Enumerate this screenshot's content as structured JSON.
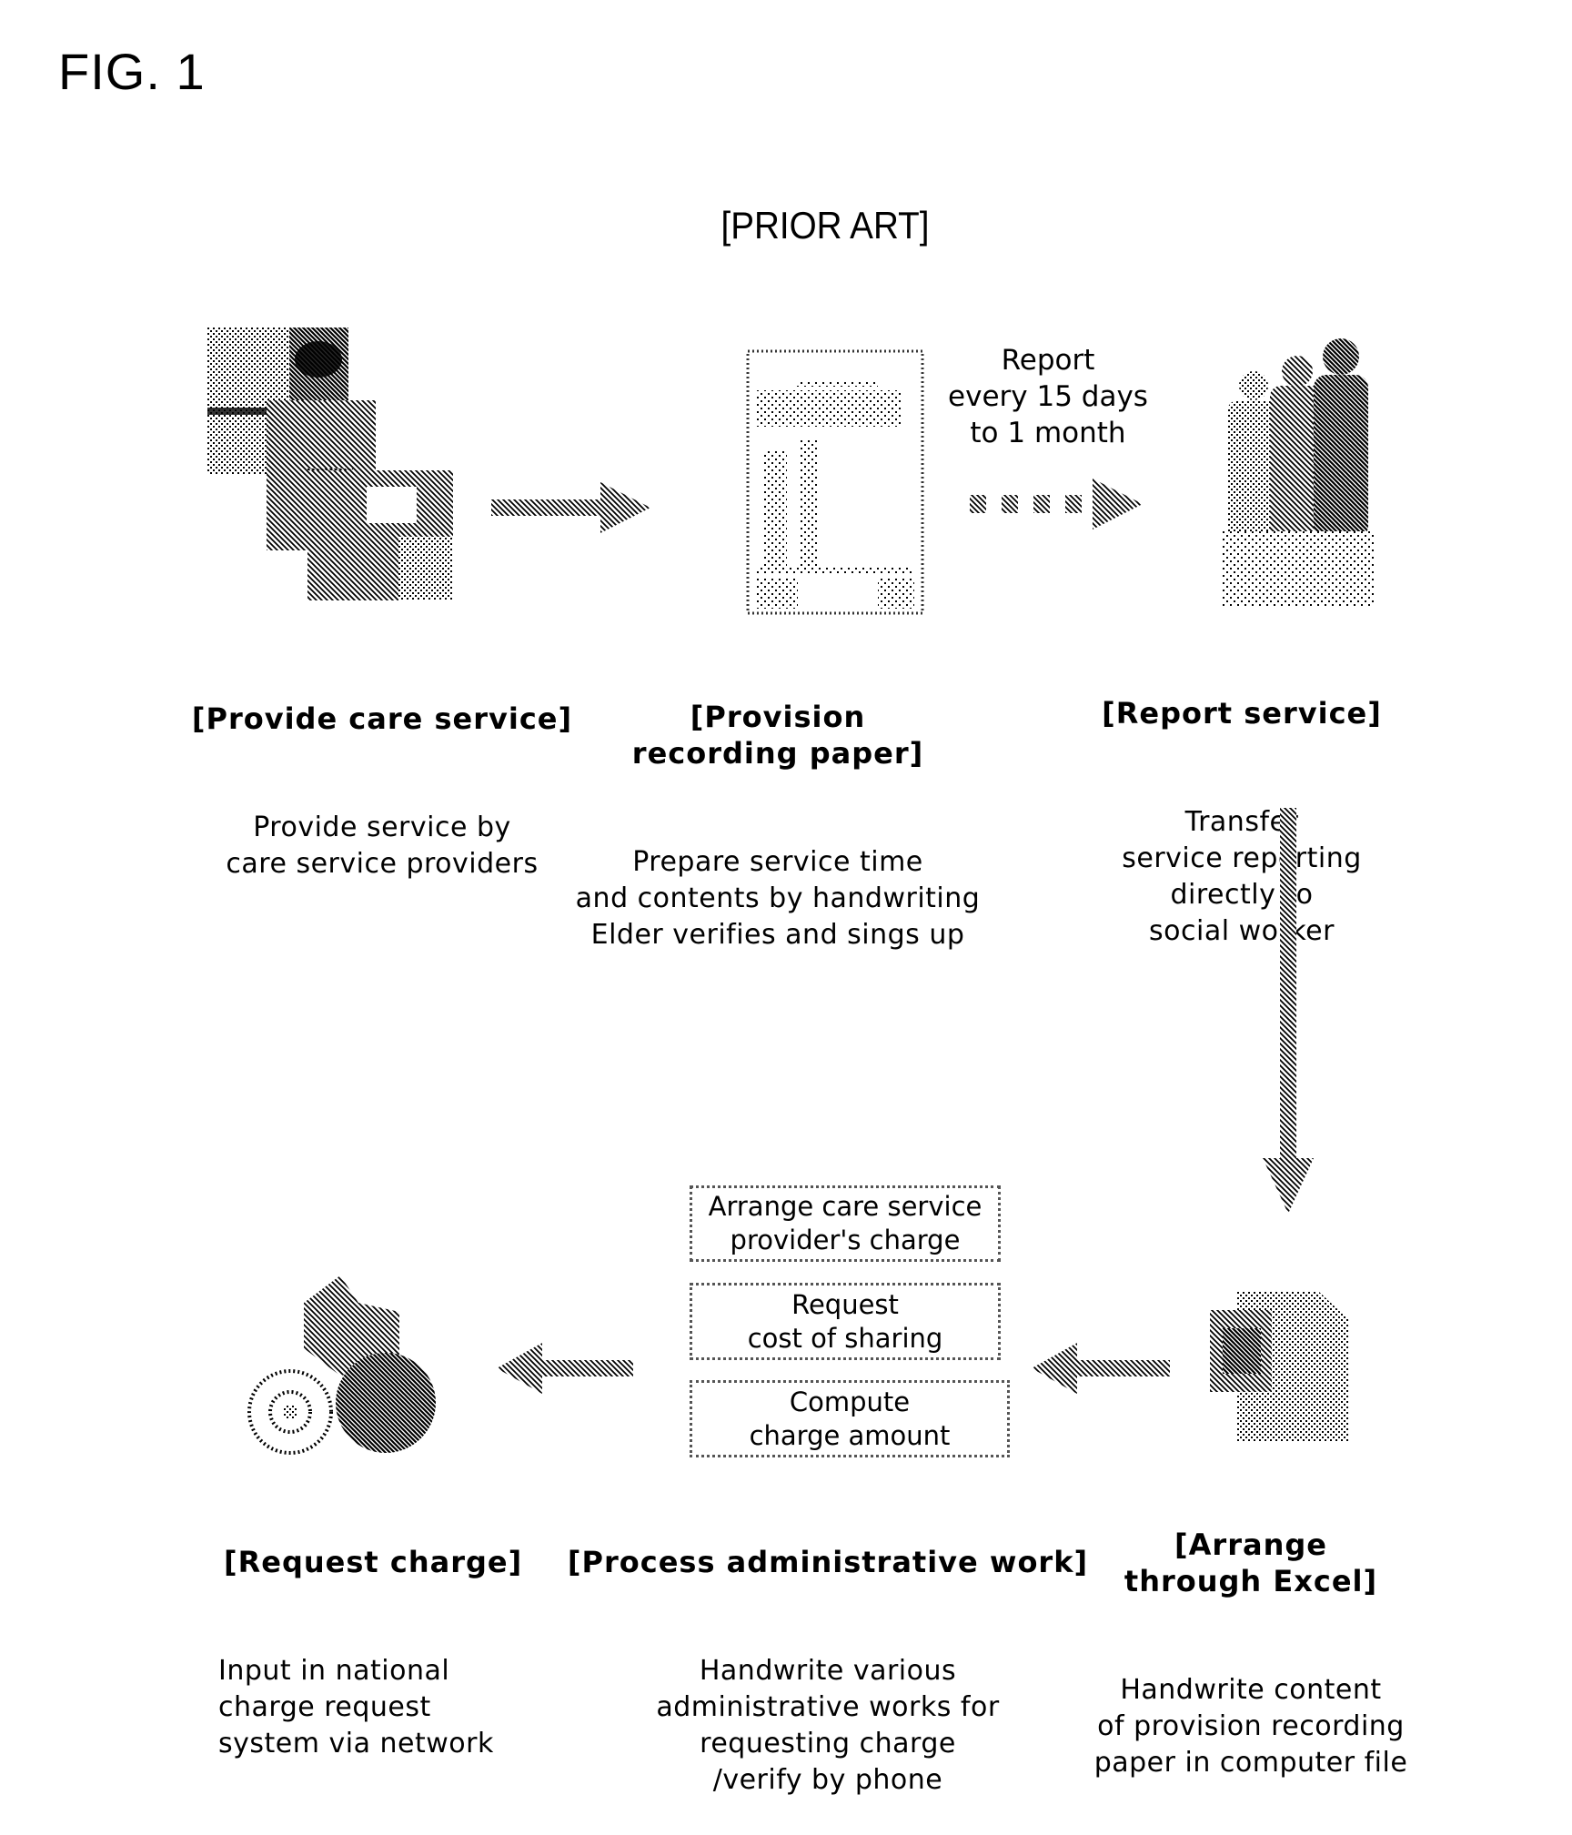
{
  "figure": {
    "title": "FIG. 1",
    "subtitle": "[PRIOR ART]"
  },
  "steps": [
    {
      "id": "provide-care-service",
      "icon": "care-photos-icon",
      "heading": "[Provide care service]",
      "description": "Provide service by\ncare service providers"
    },
    {
      "id": "provision-recording-paper",
      "icon": "recording-paper-icon",
      "heading": "[Provision\nrecording paper]",
      "description": "Prepare service time\nand contents by handwriting\nElder verifies and sings up"
    },
    {
      "id": "report-service",
      "icon": "people-icon",
      "heading": "[Report service]",
      "description": "Transfer\nservice reporting\ndirectly to\nsocial worker"
    },
    {
      "id": "arrange-through-excel",
      "icon": "excel-file-icon",
      "heading": "[Arrange\nthrough Excel]",
      "description": "Handwrite content\nof provision recording\npaper in computer file"
    },
    {
      "id": "process-administrative-work",
      "heading": "[Process administrative work]",
      "description": "Handwrite various\nadministrative works for\nrequesting charge\n/verify by phone",
      "tasks": [
        "Arrange care service\nprovider's charge",
        "Request\ncost of sharing",
        "Compute\ncharge amount"
      ]
    },
    {
      "id": "request-charge",
      "icon": "network-globe-icon",
      "heading": "[Request charge]",
      "description": "Input in national\ncharge request\nsystem via network"
    }
  ],
  "connectors": {
    "report_interval_note": "Report\nevery 15 days\nto 1 month"
  }
}
